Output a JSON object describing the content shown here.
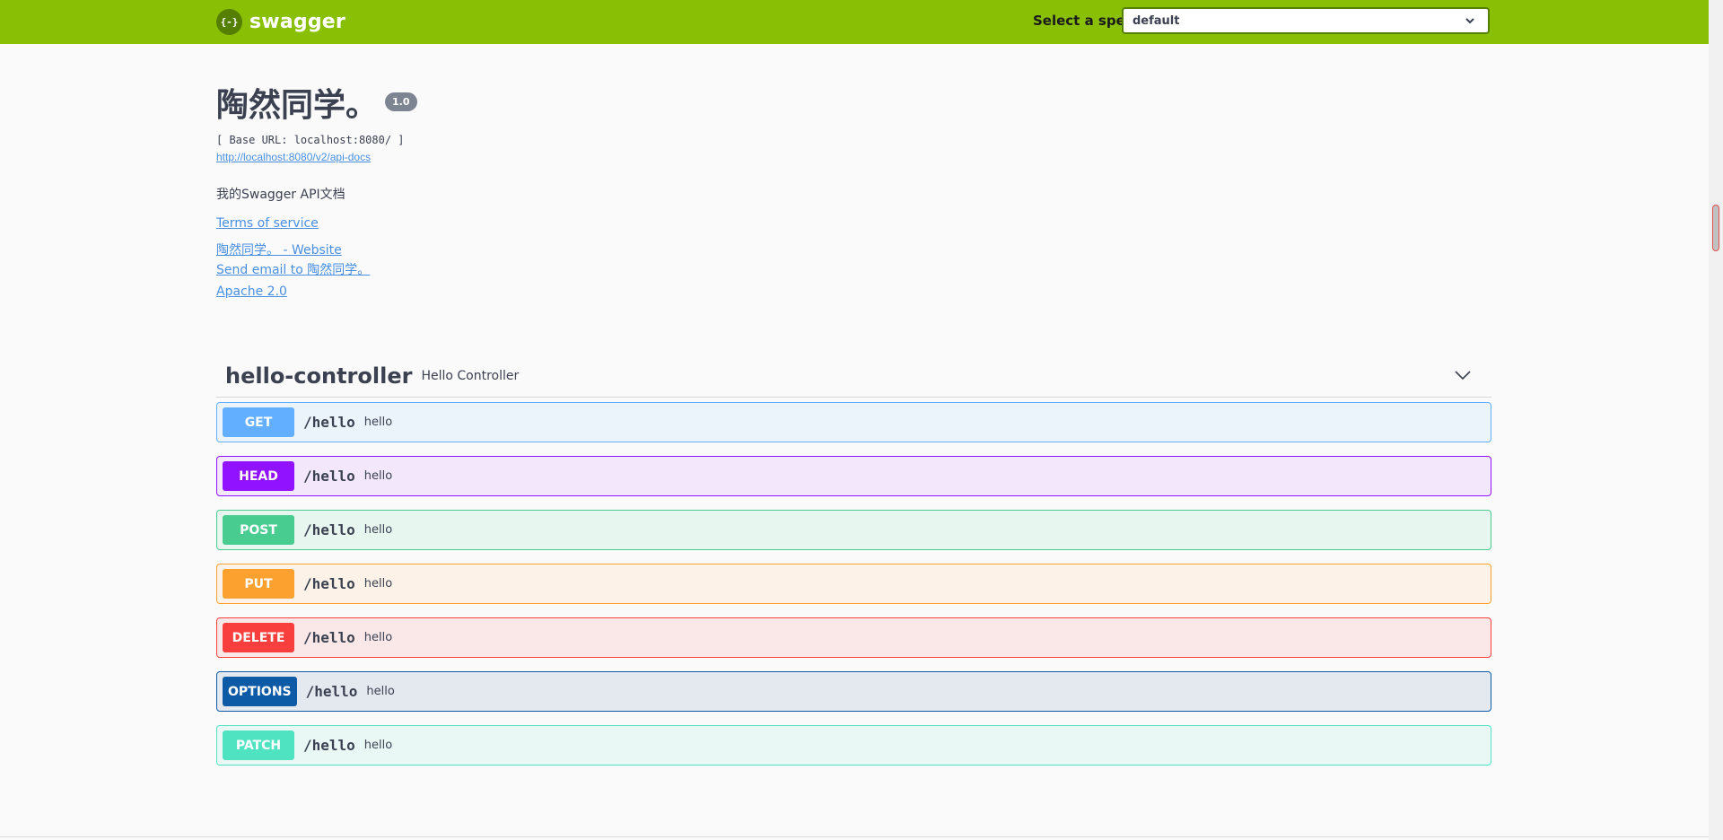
{
  "topbar": {
    "logo_icon": "{-}",
    "logo_text": "swagger",
    "spec_label": "Select a spec",
    "spec_value": "default",
    "color": "#89bf04"
  },
  "info": {
    "title": "陶然同学。",
    "version": "1.0",
    "base_url": "[ Base URL: localhost:8080/ ]",
    "api_docs": "http://localhost:8080/v2/api-docs",
    "description": "我的Swagger API文档",
    "terms": "Terms of service",
    "website": "陶然同学。 - Website",
    "email": "Send email to 陶然同学。",
    "license": "Apache 2.0"
  },
  "tag": {
    "name": "hello-controller",
    "description": "Hello Controller",
    "toggle_icon": "chevron-down-icon"
  },
  "operations": [
    {
      "method": "GET",
      "path": "/hello",
      "summary": "hello",
      "color": "#61affe",
      "bg": "#ebf3fb"
    },
    {
      "method": "HEAD",
      "path": "/hello",
      "summary": "hello",
      "color": "#9012fe",
      "bg": "#f3e7fc"
    },
    {
      "method": "POST",
      "path": "/hello",
      "summary": "hello",
      "color": "#49cc90",
      "bg": "#e8f6f0"
    },
    {
      "method": "PUT",
      "path": "/hello",
      "summary": "hello",
      "color": "#fca130",
      "bg": "#fcf2e7"
    },
    {
      "method": "DELETE",
      "path": "/hello",
      "summary": "hello",
      "color": "#f93e3e",
      "bg": "#fae7e7"
    },
    {
      "method": "OPTIONS",
      "path": "/hello",
      "summary": "hello",
      "color": "#0d5aa7",
      "bg": "#e4e9f0"
    },
    {
      "method": "PATCH",
      "path": "/hello",
      "summary": "hello",
      "color": "#50e3c2",
      "bg": "#e9f8f5"
    }
  ]
}
